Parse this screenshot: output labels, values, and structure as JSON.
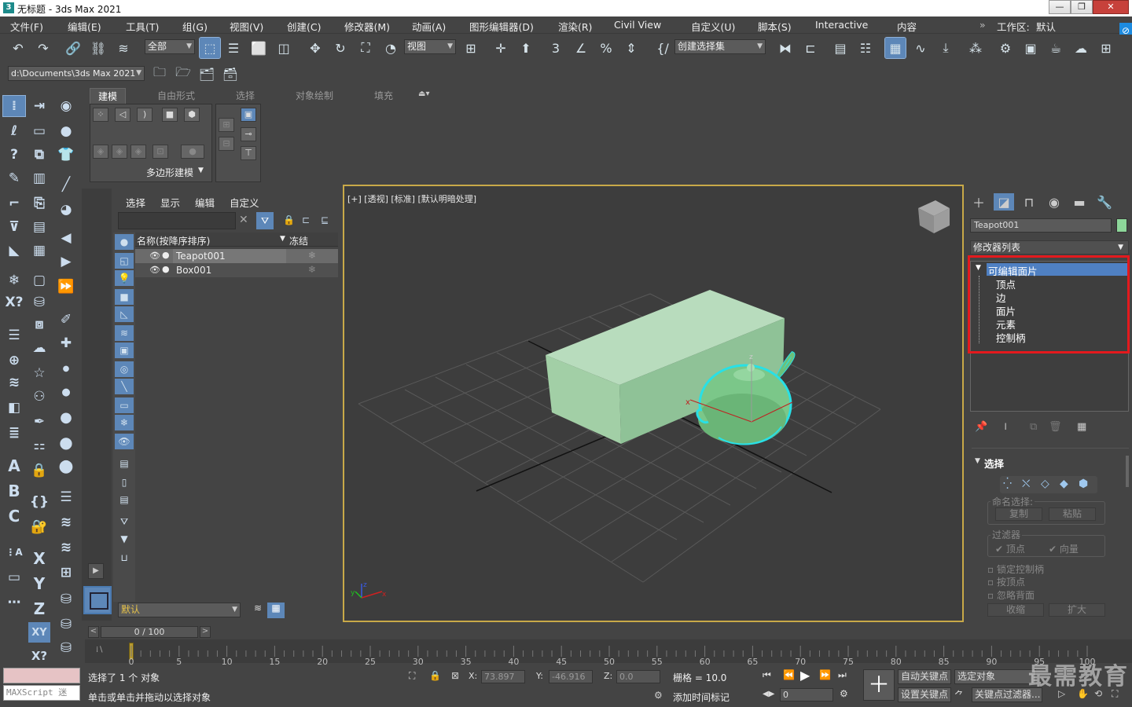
{
  "window": {
    "title": "无标题 - 3ds Max 2021"
  },
  "menu": [
    "文件(F)",
    "编辑(E)",
    "工具(T)",
    "组(G)",
    "视图(V)",
    "创建(C)",
    "修改器(M)",
    "动画(A)",
    "图形编辑器(D)",
    "渲染(R)",
    "Civil View",
    "自定义(U)",
    "脚本(S)",
    "Interactive",
    "内容"
  ],
  "workspace": {
    "label": "工作区:",
    "value": "默认"
  },
  "toolbar": {
    "filter_value": "全部",
    "coord_value": "视图",
    "selset_value": "创建选择集"
  },
  "project": {
    "path": "d:\\Documents\\3ds Max 2021"
  },
  "ribbon": {
    "tabs": [
      "建模",
      "自由形式",
      "选择",
      "对象绘制",
      "填充"
    ],
    "group_label": "多边形建模"
  },
  "scene_explorer": {
    "tabs": [
      "选择",
      "显示",
      "编辑",
      "自定义"
    ],
    "col_name": "名称(按降序排序)",
    "col_freeze": "冻结",
    "rows": [
      {
        "name": "Teapot001"
      },
      {
        "name": "Box001"
      }
    ],
    "layer_value": "默认"
  },
  "viewport": {
    "label": "[+] [透视] [标准] [默认明暗处理]"
  },
  "command_panel": {
    "object_name": "Teapot001",
    "modifier_list": "修改器列表",
    "stack": {
      "root": "可编辑面片",
      "children": [
        "顶点",
        "边",
        "面片",
        "元素",
        "控制柄"
      ]
    },
    "rollout_title": "选择",
    "named_sel": "命名选择:",
    "copy": "复制",
    "paste": "粘贴",
    "filter": "过滤器",
    "vertex_chk": "顶点",
    "vector_chk": "向量",
    "options": [
      "锁定控制柄",
      "按顶点",
      "忽略背面"
    ],
    "shrink": "收缩",
    "grow": "扩大"
  },
  "time": {
    "slider": "0 / 100",
    "ticks": [
      "0",
      "5",
      "10",
      "15",
      "20",
      "25",
      "30",
      "35",
      "40",
      "45",
      "50",
      "55",
      "60",
      "65",
      "70",
      "75",
      "80",
      "85",
      "90",
      "95",
      "100"
    ]
  },
  "status": {
    "maxscript": "MAXScript 迷",
    "selected": "选择了 1 个 对象",
    "hint": "单击或单击并拖动以选择对象",
    "x_label": "X:",
    "x": "73.897",
    "y_label": "Y:",
    "y": "-46.916",
    "z_label": "Z:",
    "z": "0.0",
    "grid": "栅格 = 10.0",
    "add_tag": "添加时间标记",
    "auto_key": "自动关键点",
    "sel_obj": "选定对象",
    "set_key": "设置关键点",
    "key_filter": "关键点过滤器...",
    "frame": "0"
  },
  "watermark": "最需教育"
}
